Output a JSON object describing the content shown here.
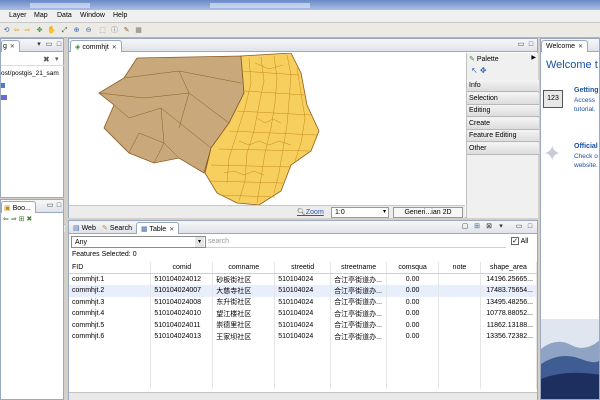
{
  "menu": [
    "Layer",
    "Map",
    "Data",
    "Window",
    "Help"
  ],
  "left_panel": {
    "tab_short": "g",
    "path": "ost/postgis_21_sam",
    "bottom_tab": "Boo..."
  },
  "map_editor": {
    "tab": "commhjt",
    "scale": "1:0",
    "zoom_label": "Zoom",
    "crs": "Generi...ian 2D"
  },
  "palette": {
    "title": "Palette",
    "sections": [
      "Info",
      "Selection",
      "Editing",
      "Create",
      "Feature Editing",
      "Other"
    ]
  },
  "welcome": {
    "tab": "Welcome",
    "heading": "Welcome t",
    "item1_title": "Getting",
    "item1_desc": [
      "Access",
      "tutorial."
    ],
    "item2_title": "Official",
    "item2_desc": [
      "Check o",
      "website."
    ]
  },
  "bottom_tabs": [
    "Web",
    "Search",
    "Table"
  ],
  "table_view": {
    "filter": "Any",
    "search_placeholder": "search",
    "all_label": "All",
    "features_selected": "Features Selected: 0",
    "columns": [
      "FID",
      "comid",
      "comname",
      "streetid",
      "streetname",
      "comsqua",
      "note",
      "shape_area"
    ],
    "rows": [
      [
        "commhjt.1",
        "510104024012",
        "砂板街社区",
        "510104024",
        "合江亭街道办...",
        "0.00",
        "",
        "14196.25665..."
      ],
      [
        "commhjt.2",
        "510104024007",
        "大慈寺社区",
        "510104024",
        "合江亭街道办...",
        "0.00",
        "",
        "17483.75654..."
      ],
      [
        "commhjt.3",
        "510104024008",
        "东升街社区",
        "510104024",
        "合江亭街道办...",
        "0.00",
        "",
        "13495.48256..."
      ],
      [
        "commhjt.4",
        "510104024010",
        "望江楼社区",
        "510104024",
        "合江亭街道办...",
        "0.00",
        "",
        "10778.88052..."
      ],
      [
        "commhjt.5",
        "510104024011",
        "崇德里社区",
        "510104024",
        "合江亭街道办...",
        "0.00",
        "",
        "11862.13188..."
      ],
      [
        "commhjt.6",
        "510104024013",
        "王家坝社区",
        "510104024",
        "合江亭街道办...",
        "0.00",
        "",
        "13356.72382..."
      ]
    ]
  },
  "colors": {
    "map_brown": "#c9a97c",
    "map_yellow": "#f7cf5e",
    "map_border": "#8b5a1f",
    "accent": "#3a66a8"
  }
}
